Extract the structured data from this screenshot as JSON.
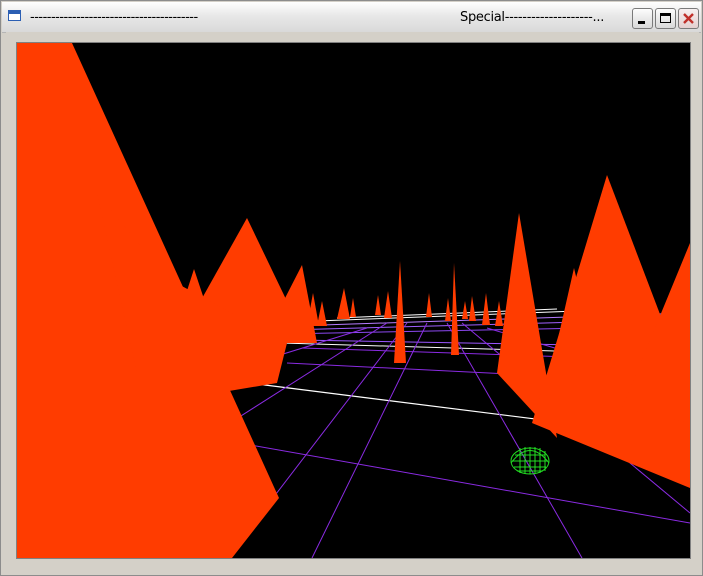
{
  "window": {
    "title_left": "----------------------------------------",
    "title_right": "Special--------------------...",
    "minimize_label": "Minimize",
    "maximize_label": "Maximize",
    "close_label": "Close"
  },
  "scene": {
    "background": "#000000",
    "spike_color": "#ff3c00",
    "grid_near_color": "#8a2be2",
    "grid_far_color": "#ffffff",
    "player_color": "#22dd22",
    "player_shape": "wireframe-dome"
  }
}
